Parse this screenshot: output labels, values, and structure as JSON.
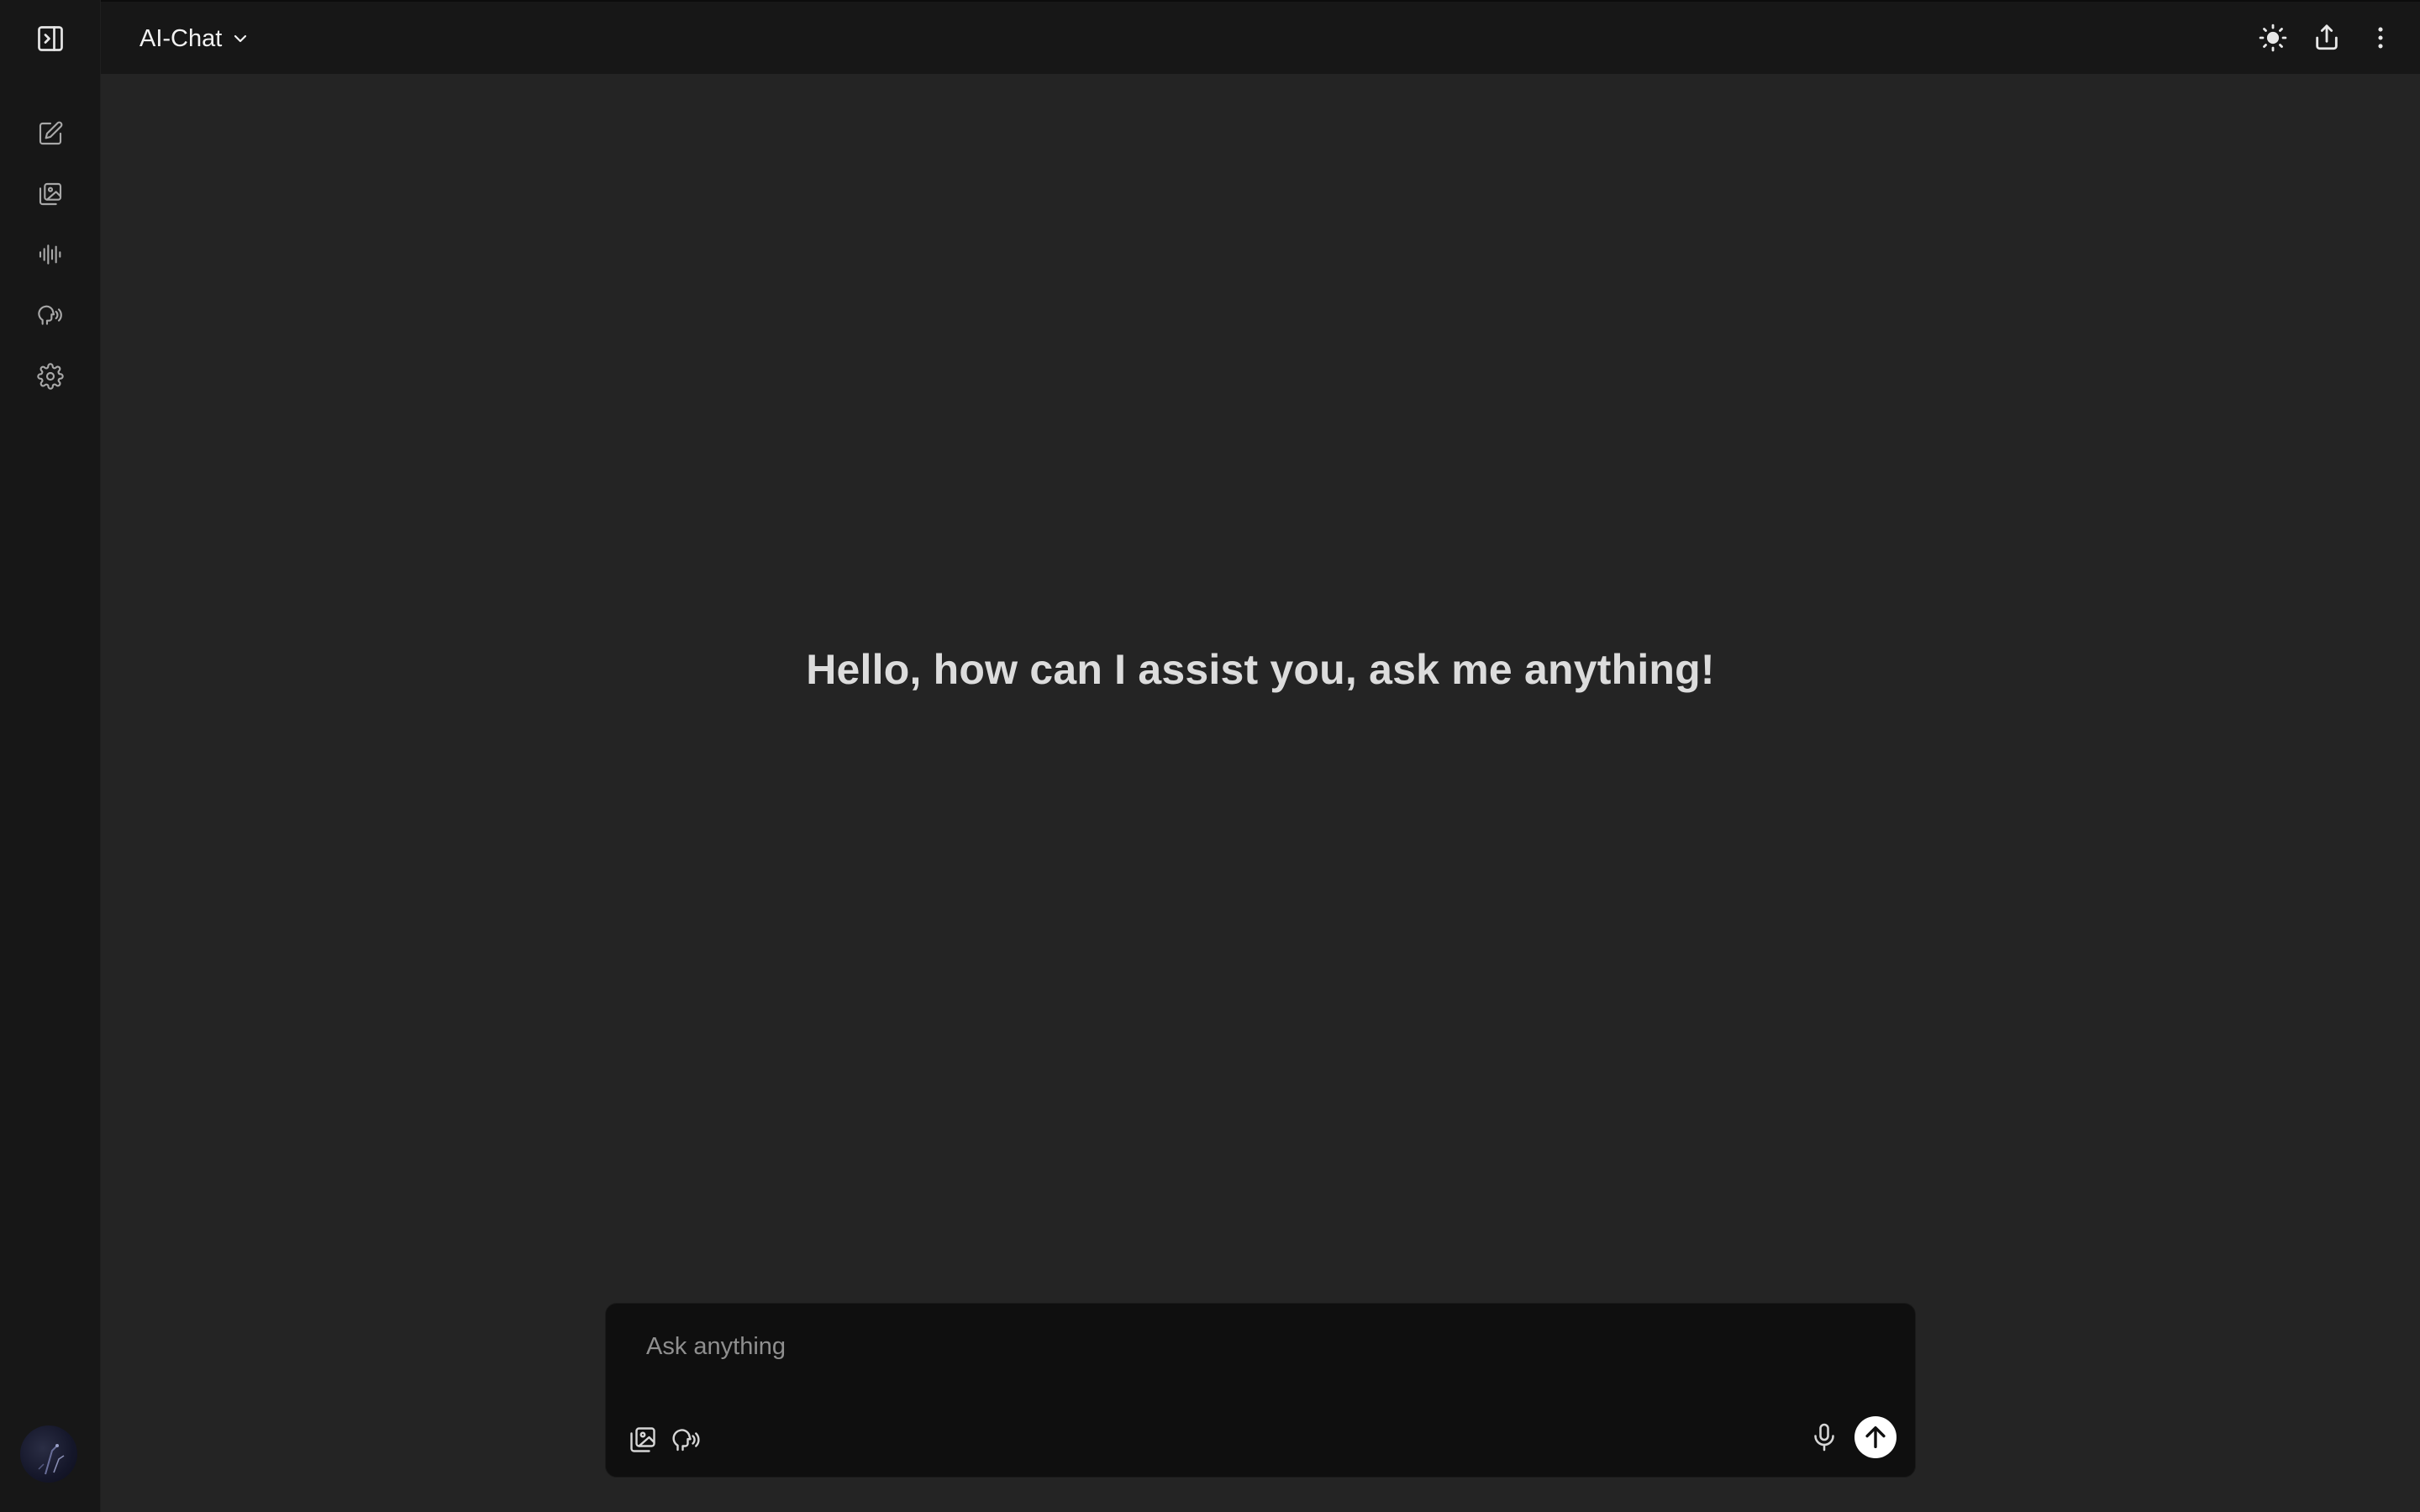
{
  "header": {
    "model_name": "AI-Chat",
    "model_dropdown_icon": "chevron-down-icon",
    "actions": [
      {
        "name": "theme-toggle",
        "icon": "sun-icon"
      },
      {
        "name": "share",
        "icon": "share-icon"
      },
      {
        "name": "more-options",
        "icon": "kebab-icon"
      }
    ]
  },
  "sidebar": {
    "toggle_icon": "sidebar-toggle-icon",
    "items": [
      {
        "name": "new-chat",
        "icon": "edit-icon"
      },
      {
        "name": "image-gallery",
        "icon": "image-stack-icon"
      },
      {
        "name": "audio",
        "icon": "waveform-icon"
      },
      {
        "name": "voice",
        "icon": "speak-head-icon"
      },
      {
        "name": "settings",
        "icon": "gear-icon"
      }
    ],
    "avatar": "user-avatar"
  },
  "main": {
    "greeting": "Hello, how can I assist you, ask me anything!"
  },
  "composer": {
    "placeholder": "Ask anything",
    "value": "",
    "left_actions": [
      {
        "name": "attach-image",
        "icon": "image-stack-icon"
      },
      {
        "name": "voice-mode",
        "icon": "speak-head-icon"
      }
    ],
    "right_actions": [
      {
        "name": "microphone",
        "icon": "microphone-icon"
      },
      {
        "name": "send",
        "icon": "arrow-up-icon"
      }
    ]
  },
  "colors": {
    "background": "#242424",
    "sidebar": "#171717",
    "header": "#171717",
    "composer": "#0f0f0f",
    "send_button": "#ffffff",
    "greeting_text": "#dcdcdc"
  }
}
